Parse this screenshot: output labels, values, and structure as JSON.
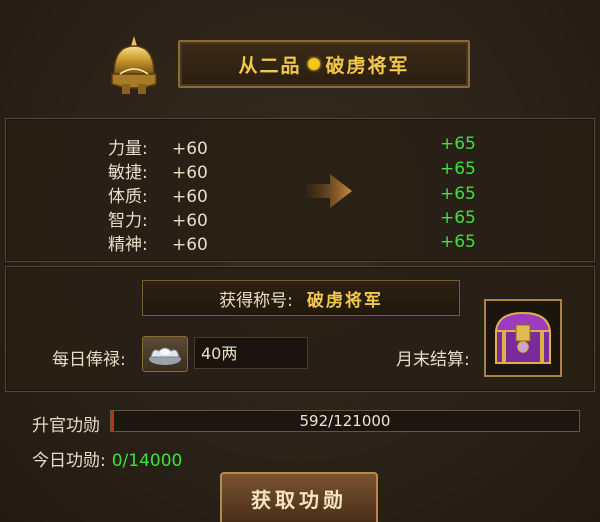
{
  "header": {
    "rank": "从二品",
    "title": "破虏将军"
  },
  "stats": [
    {
      "name": "力量:",
      "current": "+60",
      "next": "+65"
    },
    {
      "name": "敏捷:",
      "current": "+60",
      "next": "+65"
    },
    {
      "name": "体质:",
      "current": "+60",
      "next": "+65"
    },
    {
      "name": "智力:",
      "current": "+60",
      "next": "+65"
    },
    {
      "name": "精神:",
      "current": "+60",
      "next": "+65"
    }
  ],
  "title_section": {
    "label": "获得称号:",
    "value": "破虏将军"
  },
  "salary": {
    "label": "每日俸禄:",
    "value": "40两"
  },
  "month_settlement": {
    "label": "月末结算:"
  },
  "merit": {
    "label": "升官功勋",
    "progress_text": "592/121000",
    "current": 592,
    "max": 121000
  },
  "today": {
    "label": "今日功勋:",
    "value": "0/14000"
  },
  "button": {
    "label": "获取功勋"
  },
  "colors": {
    "gold": "#f2c94c",
    "green": "#3be33b",
    "bar_fill": "#b8331c"
  },
  "icons": {
    "helmet": "helmet-icon",
    "arrow": "arrow-right-icon",
    "silver": "silver-ingot-icon",
    "chest": "treasure-chest-icon"
  }
}
